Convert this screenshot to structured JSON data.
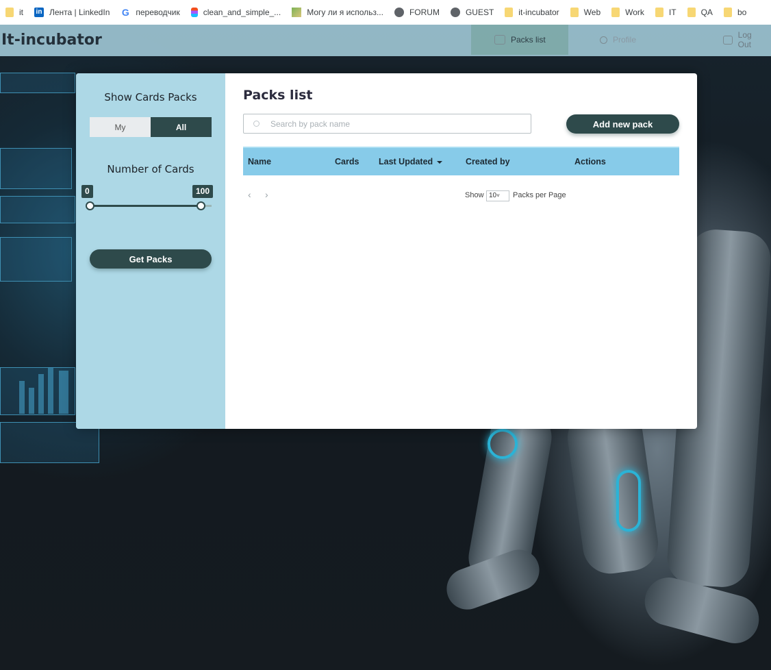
{
  "bookmarks": [
    {
      "label": "it",
      "icon": "folder-icon"
    },
    {
      "label": "Лента | LinkedIn",
      "icon": "linkedin-icon"
    },
    {
      "label": "переводчик",
      "icon": "google-icon"
    },
    {
      "label": "clean_and_simple_...",
      "icon": "figma-icon"
    },
    {
      "label": "Могу ли я использ...",
      "icon": "image-icon"
    },
    {
      "label": "FORUM",
      "icon": "globe-icon"
    },
    {
      "label": "GUEST",
      "icon": "globe-icon"
    },
    {
      "label": "it-incubator",
      "icon": "folder-icon"
    },
    {
      "label": "Web",
      "icon": "folder-icon"
    },
    {
      "label": "Work",
      "icon": "folder-icon"
    },
    {
      "label": "IT",
      "icon": "folder-icon"
    },
    {
      "label": "QA",
      "icon": "folder-icon"
    },
    {
      "label": "bo",
      "icon": "folder-icon"
    }
  ],
  "header": {
    "logo": "It-incubator",
    "nav": {
      "packs": "Packs list",
      "profile": "Profile",
      "logout": "Log Out"
    }
  },
  "sidebar": {
    "title": "Show Cards Packs",
    "toggle": {
      "my": "My",
      "all": "All",
      "selected": "All"
    },
    "cards_title": "Number of Cards",
    "range": {
      "min": 0,
      "max": 100,
      "min_label": "0",
      "max_label": "100"
    },
    "get_button": "Get Packs"
  },
  "main": {
    "title": "Packs list",
    "search_placeholder": "Search by pack name",
    "add_button": "Add new pack",
    "columns": [
      "Name",
      "Cards",
      "Last Updated",
      "Created by",
      "Actions"
    ],
    "rows": [],
    "pagination": {
      "show_label": "Show",
      "per_page_value": "10",
      "per_page_label": "Packs per Page"
    }
  },
  "colors": {
    "accent": "#2e4a4b",
    "sidebar_bg": "#add8e6",
    "table_header": "#87cbe9"
  }
}
